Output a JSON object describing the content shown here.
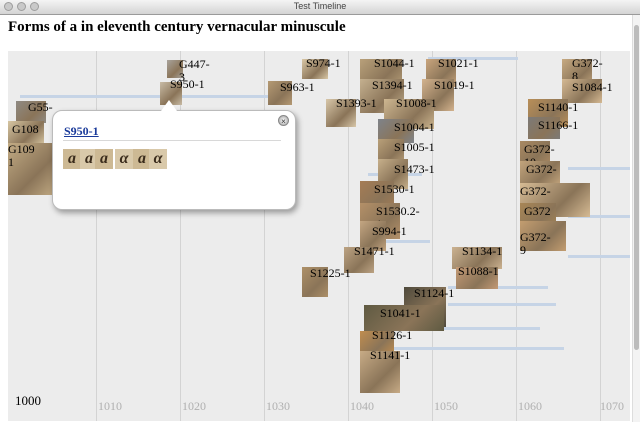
{
  "window": {
    "title": "Test Timeline"
  },
  "heading": "Forms of a in eleventh century vernacular minuscule",
  "axis": {
    "start_year": "1000",
    "ticks": [
      "1010",
      "1020",
      "1030",
      "1040",
      "1050",
      "1060",
      "1070"
    ]
  },
  "events": [
    {
      "label": "G447-\n3",
      "color": "#a8a39b"
    },
    {
      "label": "S950-1",
      "color": "#c8bba5"
    },
    {
      "label": "S974-1",
      "color": "#d9c7a6"
    },
    {
      "label": "S963-1",
      "color": "#b59a74"
    },
    {
      "label": "G55-",
      "color": "#8f8a83"
    },
    {
      "label": "G108",
      "color": "#d7c6a2"
    },
    {
      "label": "G109\n1",
      "color": "#c2ab84"
    },
    {
      "label": "S1044-1",
      "color": "#b8a07a"
    },
    {
      "label": "S1021-1",
      "color": "#c9a57d"
    },
    {
      "label": "S1394-1",
      "color": "#c4b08f"
    },
    {
      "label": "S1019-1",
      "color": "#d4b38e"
    },
    {
      "label": "S1393-1",
      "color": "#d8c7a9"
    },
    {
      "label": "S1008-1",
      "color": "#cdb690"
    },
    {
      "label": "S1004-1",
      "color": "#7e838a"
    },
    {
      "label": "S1005-1",
      "color": "#b9a079"
    },
    {
      "label": "S1473-1",
      "color": "#c7b08b"
    },
    {
      "label": "S1530-1",
      "color": "#a57c55"
    },
    {
      "label": "S1530.2-\n1",
      "color": "#b49068"
    },
    {
      "label": "S994-1",
      "color": "#c4a682"
    },
    {
      "label": "S1471-1",
      "color": "#bca383"
    },
    {
      "label": "S1225-1",
      "color": "#ad9068"
    },
    {
      "label": "S1134-1",
      "color": "#cbb291"
    },
    {
      "label": "S1088-1",
      "color": "#c49a75"
    },
    {
      "label": "S1124-1",
      "color": "#4f4a3c"
    },
    {
      "label": "S1041-1",
      "color": "#5f5a42"
    },
    {
      "label": "S1126-1",
      "color": "#c08d4f"
    },
    {
      "label": "S1141-1",
      "color": "#c7ab86"
    },
    {
      "label": "G372-\n8",
      "color": "#c7aa82"
    },
    {
      "label": "S1084-1",
      "color": "#d5b993"
    },
    {
      "label": "S1140-1",
      "color": "#b98f58"
    },
    {
      "label": "S1166-1",
      "color": "#7c7a78"
    },
    {
      "label": "G372-\n10",
      "color": "#a98962"
    },
    {
      "label": "G372-",
      "color": "#c2a47c"
    },
    {
      "label": "G372-",
      "color": "#d6bb94"
    },
    {
      "label": "G372",
      "color": "#a88656"
    },
    {
      "label": "G372-\n9",
      "color": "#c39d70"
    }
  ],
  "popup": {
    "title": "S950-1",
    "close_icon": "close-icon",
    "glyphs": [
      "a",
      "a",
      "a",
      "α",
      "a",
      "α"
    ]
  }
}
